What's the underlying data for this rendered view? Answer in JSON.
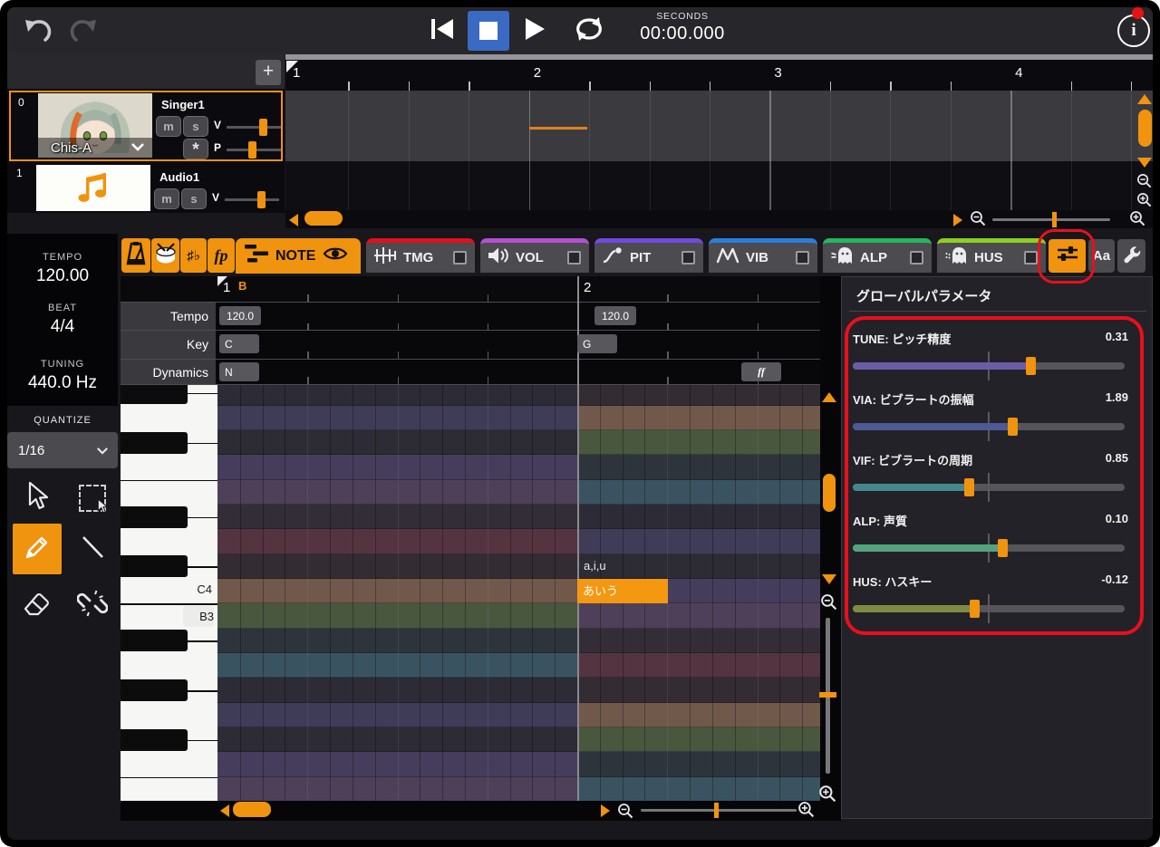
{
  "topbar": {
    "seconds_label": "SECONDS",
    "time_value": "00:00.000",
    "info_glyph": "i"
  },
  "track_panel": {
    "add_button": "+",
    "tracks": [
      {
        "index": "0",
        "name": "Singer1",
        "voice": "Chis-A",
        "mute": "m",
        "solo": "s",
        "volume_label": "V",
        "pan_label": "P",
        "freeze_label": "*"
      },
      {
        "index": "1",
        "name": "Audio1",
        "mute": "m",
        "solo": "s",
        "volume_label": "V"
      }
    ]
  },
  "timeline": {
    "measures": [
      "1",
      "2",
      "3",
      "4"
    ]
  },
  "sidebar": {
    "tempo_label": "TEMPO",
    "tempo_value": "120.00",
    "beat_label": "BEAT",
    "beat_value": "4/4",
    "tuning_label": "TUNING",
    "tuning_value": "440.0 Hz",
    "quantize_label": "QUANTIZE",
    "quantize_value": "1/16"
  },
  "tabbar": {
    "accidental_label": "♯♭",
    "dynamics_label": "fp",
    "note_tab": "NOTE",
    "tabs": [
      {
        "label": "TMG",
        "color": "#e0101f"
      },
      {
        "label": "VOL",
        "color": "#b44fd4"
      },
      {
        "label": "PIT",
        "color": "#6f49e0"
      },
      {
        "label": "VIB",
        "color": "#2b7ddd"
      },
      {
        "label": "ALP",
        "color": "#27b561"
      },
      {
        "label": "HUS",
        "color": "#8ecf1f"
      }
    ],
    "text_style_label": "Aa"
  },
  "score": {
    "ruler": {
      "measure_1": "1",
      "marker": "B",
      "measure_2": "2"
    },
    "row_labels": {
      "tempo": "Tempo",
      "key": "Key",
      "dynamics": "Dynamics"
    },
    "events": {
      "tempo_1": "120.0",
      "tempo_2": "120.0",
      "key_1": "C",
      "key_2": "G",
      "dynamics_1": "N",
      "dynamics_2": "ff"
    }
  },
  "piano_roll": {
    "c4_label": "C4",
    "b3_label": "B3",
    "note": {
      "lyric": "あいう",
      "phoneme": "a,i,u"
    },
    "pitch_class_colors": [
      "#70594b",
      "#332c33",
      "#533440",
      "#332d38",
      "#4f4059",
      "#463d5c",
      "#2d2b33",
      "#3f3c58",
      "#2c2b36",
      "#3a5360",
      "#2e343c",
      "#49573f"
    ],
    "key_section_shift": 5
  },
  "params": {
    "title": "グローバルパラメータ",
    "items": [
      {
        "label": "TUNE: ピッチ精度",
        "value": "0.31",
        "fill": "#6b5ca8",
        "pos": 0.655
      },
      {
        "label": "VIA: ビブラートの振幅",
        "value": "1.89",
        "fill": "#4d5a96",
        "pos": 0.587
      },
      {
        "label": "VIF: ビブラートの周期",
        "value": "0.85",
        "fill": "#44888c",
        "pos": 0.426
      },
      {
        "label": "ALP: 声質",
        "value": "0.10",
        "fill": "#55a37c",
        "pos": 0.55
      },
      {
        "label": "HUS: ハスキー",
        "value": "-0.12",
        "fill": "#7e8c42",
        "pos": 0.447
      }
    ]
  },
  "colors": {
    "accent_orange": "#f0930e",
    "annotation_red": "#e8101c",
    "stop_active_blue": "#3a6ac4",
    "note_orange": "#f49812"
  }
}
